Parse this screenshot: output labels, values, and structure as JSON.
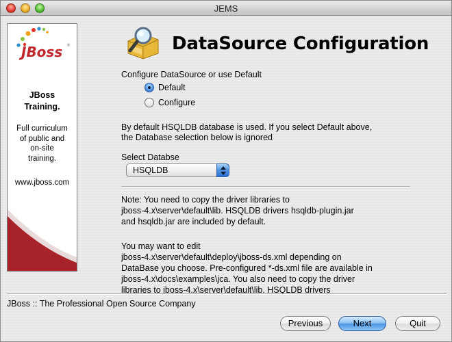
{
  "window": {
    "title": "JEMS"
  },
  "sidebar": {
    "logo_text": "JBoss",
    "heading_line1": "JBoss",
    "heading_line2": "Training.",
    "body_lines": [
      "Full curriculum",
      "of public and",
      "on-site",
      "training."
    ],
    "url": "www.jboss.com"
  },
  "header": {
    "title": "DataSource Configuration",
    "icon": "folder-magnifier-icon"
  },
  "config": {
    "prompt": "Configure DataSource or use Default",
    "options": [
      {
        "label": "Default",
        "selected": true
      },
      {
        "label": "Configure",
        "selected": false
      }
    ],
    "info_line1": "By default HSQLDB database is used. If you select Default above,",
    "info_line2": "the Database selection below is ignored"
  },
  "database": {
    "label": "Select Databse",
    "selected": "HSQLDB"
  },
  "note": {
    "lines": [
      "Note: You need to copy the driver libraries to",
      "jboss-4.x\\server\\default\\lib. HSQLDB drivers hsqldb-plugin.jar",
      "and hsqldb.jar are included by default."
    ]
  },
  "extra": {
    "lines": [
      "You may want to edit",
      "jboss-4.x\\server\\default\\deploy\\jboss-ds.xml depending on",
      "DataBase you choose. Pre-configured *-ds.xml file are available in",
      "jboss-4.x\\docs\\examples\\jca. You also need to copy the driver",
      "libraries to jboss-4.x\\server\\default\\lib. HSQLDB drivers"
    ]
  },
  "footer": {
    "company": "JBoss :: The Professional Open Source Company",
    "buttons": {
      "previous": "Previous",
      "next": "Next",
      "quit": "Quit"
    }
  },
  "colors": {
    "jboss_red": "#c0272d",
    "accent_blue": "#4f97e4"
  }
}
